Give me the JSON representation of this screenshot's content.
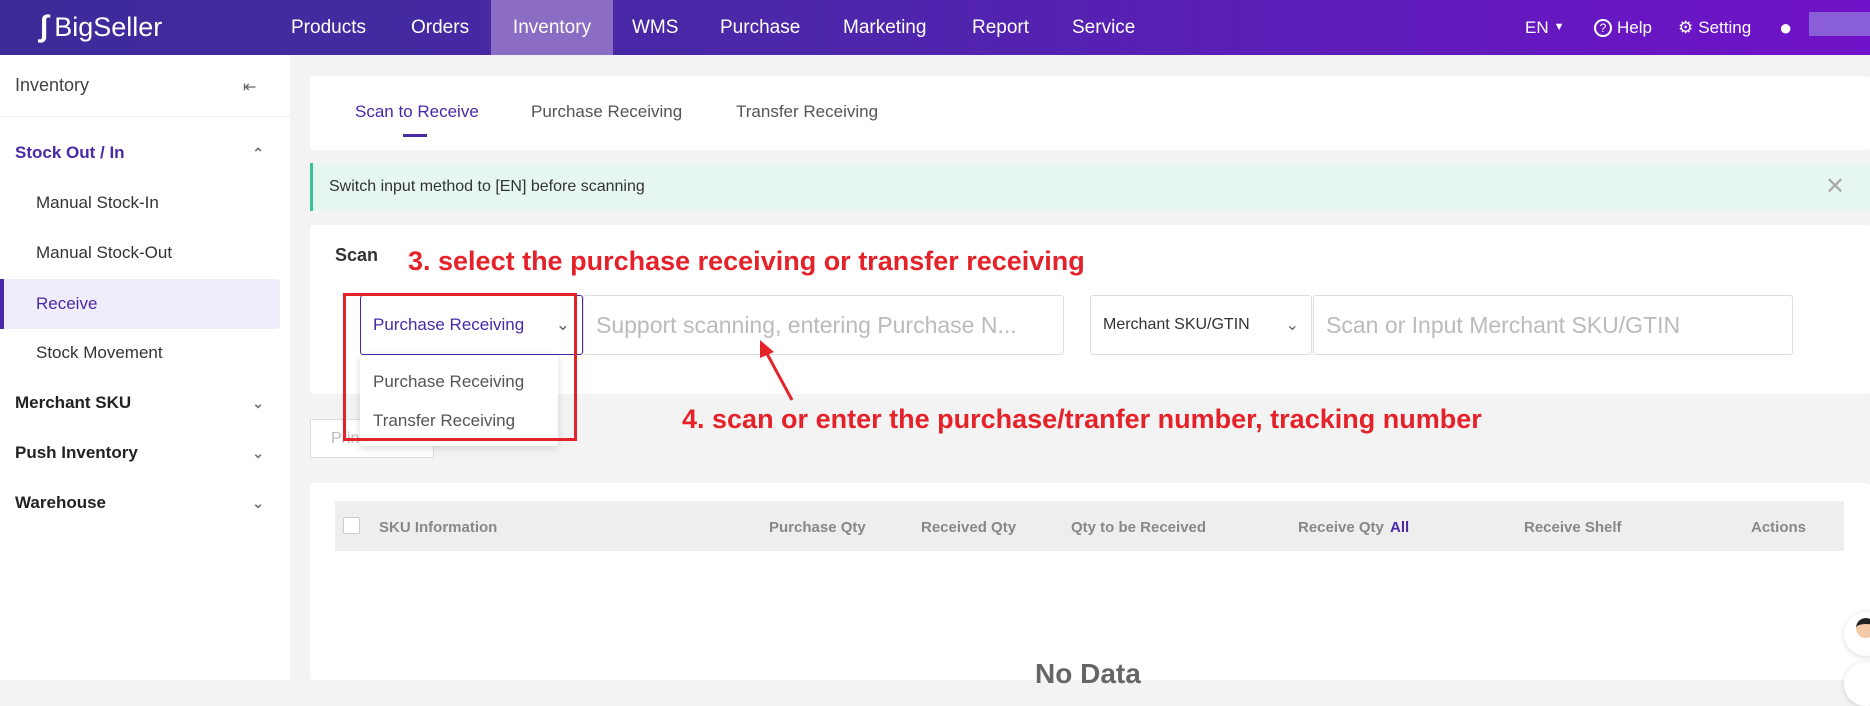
{
  "header": {
    "logo": "BigSeller",
    "nav": [
      "Products",
      "Orders",
      "Inventory",
      "WMS",
      "Purchase",
      "Marketing",
      "Report",
      "Service"
    ],
    "active": "Inventory",
    "lang": "EN",
    "help": "Help",
    "setting": "Setting"
  },
  "sidebar": {
    "title": "Inventory",
    "groups": [
      {
        "label": "Stock Out / In",
        "expanded": true,
        "items": [
          "Manual Stock-In",
          "Manual Stock-Out",
          "Receive",
          "Stock Movement"
        ],
        "selected": "Receive"
      },
      {
        "label": "Merchant SKU"
      },
      {
        "label": "Push Inventory"
      },
      {
        "label": "Warehouse"
      }
    ]
  },
  "tabs": [
    "Scan to Receive",
    "Purchase Receiving",
    "Transfer Receiving"
  ],
  "alert": "Switch input method to [EN] before scanning",
  "scan": {
    "label": "Scan",
    "type_select": "Purchase Receiving",
    "type_options": [
      "Purchase Receiving",
      "Transfer Receiving"
    ],
    "number_placeholder": "Support scanning, entering Purchase N...",
    "sku_select": "Merchant SKU/GTIN",
    "sku_placeholder": "Scan or Input Merchant SKU/GTIN"
  },
  "print_button": "Print",
  "table": {
    "columns": [
      "SKU Information",
      "Purchase Qty",
      "Received Qty",
      "Qty to be Received",
      "Receive Qty",
      "Receive Shelf",
      "Actions"
    ],
    "receive_qty_link": "All",
    "empty": "No Data"
  },
  "annotations": {
    "step3": "3. select the purchase receiving or transfer receiving",
    "step4": "4. scan or enter the purchase/tranfer number, tracking number"
  },
  "colors": {
    "brand": "#4a28a8",
    "annotation": "#e5222a"
  }
}
